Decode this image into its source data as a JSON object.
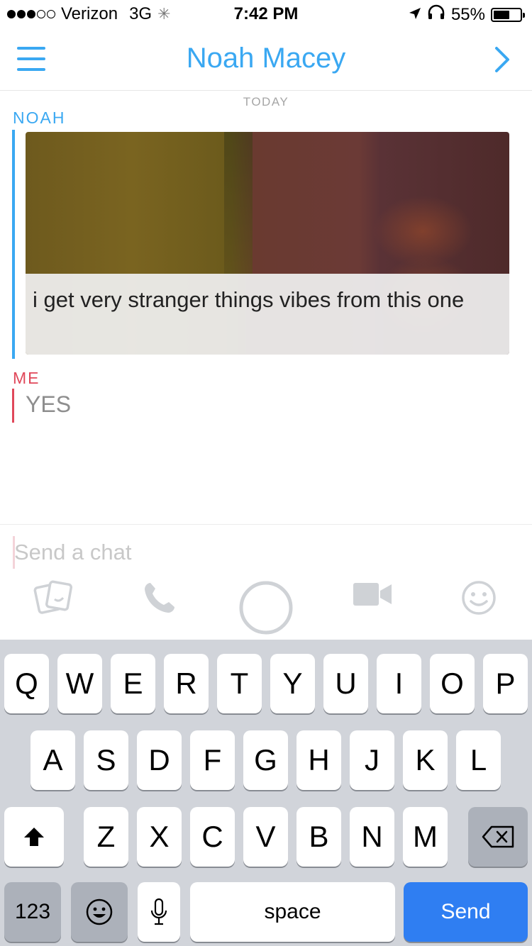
{
  "status_bar": {
    "carrier": "Verizon",
    "network": "3G",
    "time": "7:42 PM",
    "battery": "55%"
  },
  "header": {
    "title": "Noah Macey"
  },
  "chat": {
    "day_label": "TODAY",
    "messages": [
      {
        "sender": "NOAH",
        "caption": "i get very stranger things vibes from this one"
      },
      {
        "sender": "ME",
        "text": "YES"
      }
    ]
  },
  "composer": {
    "placeholder": "Send a chat"
  },
  "keyboard": {
    "row1": [
      "Q",
      "W",
      "E",
      "R",
      "T",
      "Y",
      "U",
      "I",
      "O",
      "P"
    ],
    "row2": [
      "A",
      "S",
      "D",
      "F",
      "G",
      "H",
      "J",
      "K",
      "L"
    ],
    "row3": [
      "Z",
      "X",
      "C",
      "V",
      "B",
      "N",
      "M"
    ],
    "numbers_label": "123",
    "space_label": "space",
    "send_label": "Send"
  },
  "colors": {
    "accent_blue": "#3aa8f2",
    "me_red": "#e0485a",
    "send_blue": "#2f7ef2",
    "keyboard_bg": "#d1d4da"
  }
}
